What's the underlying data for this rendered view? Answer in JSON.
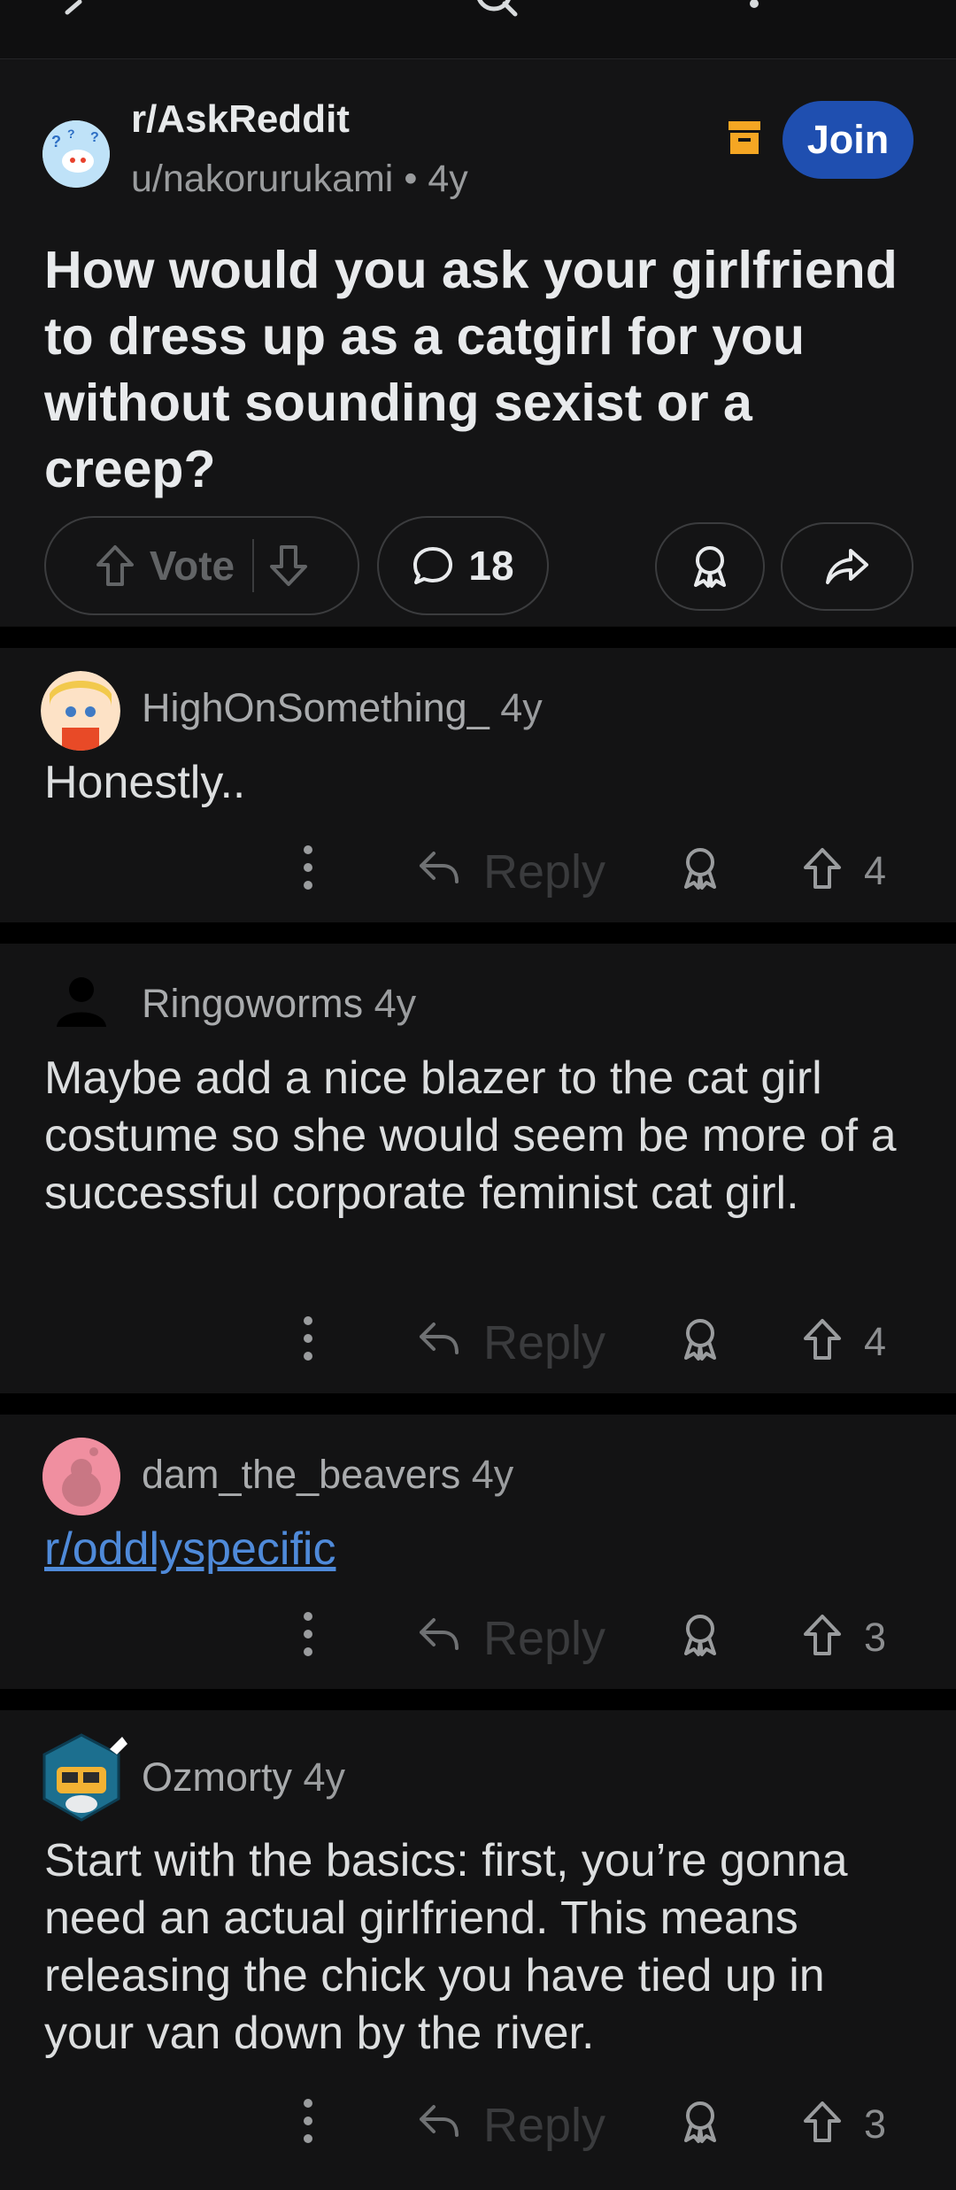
{
  "post": {
    "subreddit": "r/AskReddit",
    "author": "u/nakorurukami",
    "age": "4y",
    "join_label": "Join",
    "title": "How would you ask your girlfriend to dress up as a catgirl for you without sounding sexist or a creep?",
    "vote_label": "Vote",
    "comment_count": "18"
  },
  "comments": [
    {
      "author": "HighOnSomething_",
      "age": "4y",
      "body": "Honestly..",
      "reply_label": "Reply",
      "score": "4"
    },
    {
      "author": "Ringoworms",
      "age": "4y",
      "body": "Maybe add a nice blazer to the cat girl costume so she would seem be more of a successful corporate feminist cat girl.",
      "reply_label": "Reply",
      "score": "4"
    },
    {
      "author": "dam_the_beavers",
      "age": "4y",
      "body": "r/oddlyspecific",
      "reply_label": "Reply",
      "score": "3"
    },
    {
      "author": "Ozmorty",
      "age": "4y",
      "body": "Start with the basics: first, you’re gonna need an actual girlfriend.  This means releasing the chick you have tied up in your van down by the river.",
      "reply_label": "Reply",
      "score": "3"
    }
  ],
  "icons": [
    "back-arrow-icon",
    "search-icon",
    "more-icon",
    "archive-icon",
    "upvote-icon",
    "downvote-icon",
    "comment-icon",
    "award-icon",
    "share-icon",
    "reply-icon"
  ],
  "colors": {
    "background": "#111112",
    "join_button": "#1f4fb0",
    "archive": "#f5a623",
    "link": "#4f8ad9"
  }
}
